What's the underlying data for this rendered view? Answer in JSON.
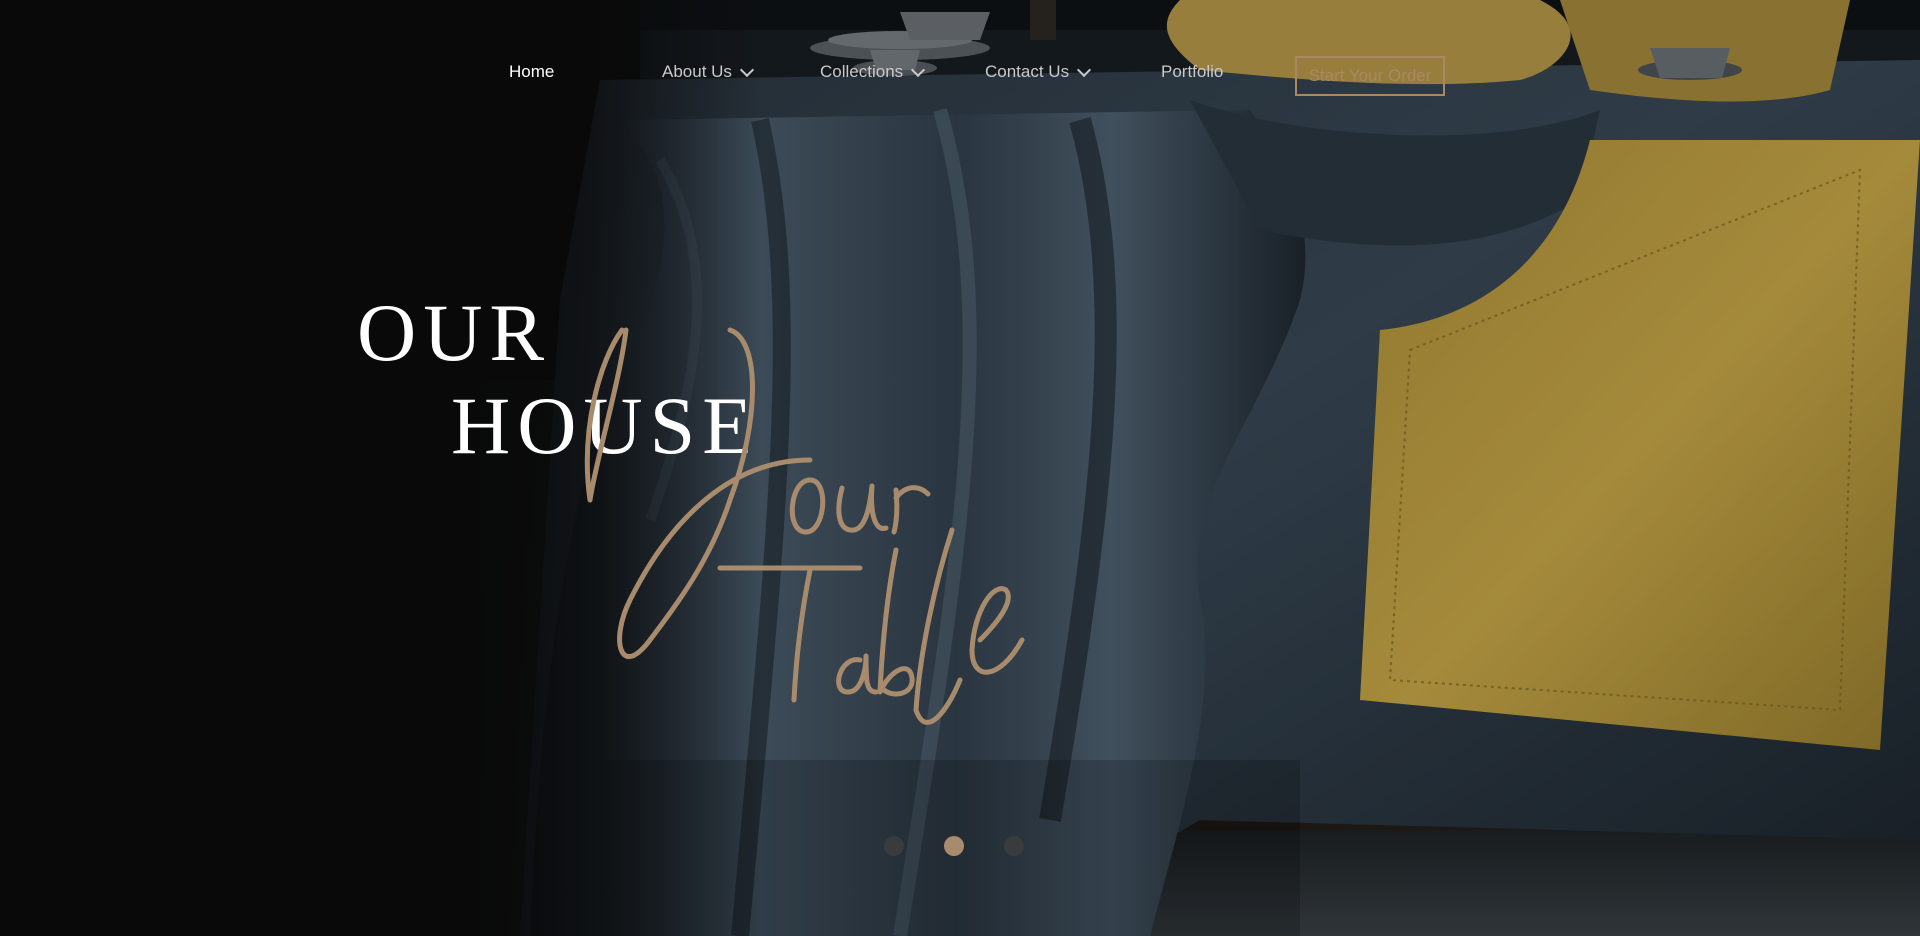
{
  "nav": {
    "items": [
      {
        "label": "Home",
        "has_dropdown": false,
        "active": true
      },
      {
        "label": "About Us",
        "has_dropdown": true,
        "active": false
      },
      {
        "label": "Collections",
        "has_dropdown": true,
        "active": false
      },
      {
        "label": "Contact Us",
        "has_dropdown": true,
        "active": false
      },
      {
        "label": "Portfolio",
        "has_dropdown": false,
        "active": false
      }
    ],
    "cta_label": "Start Your Order"
  },
  "hero": {
    "line1": "OUR",
    "line2": "HOUSE",
    "script_text": "Your Table"
  },
  "slider": {
    "dot_count": 3,
    "active_index": 1
  },
  "colors": {
    "accent": "#a98863",
    "background": "#0b0c0d",
    "text": "#ffffff",
    "nav_text": "#c9c9c9"
  }
}
